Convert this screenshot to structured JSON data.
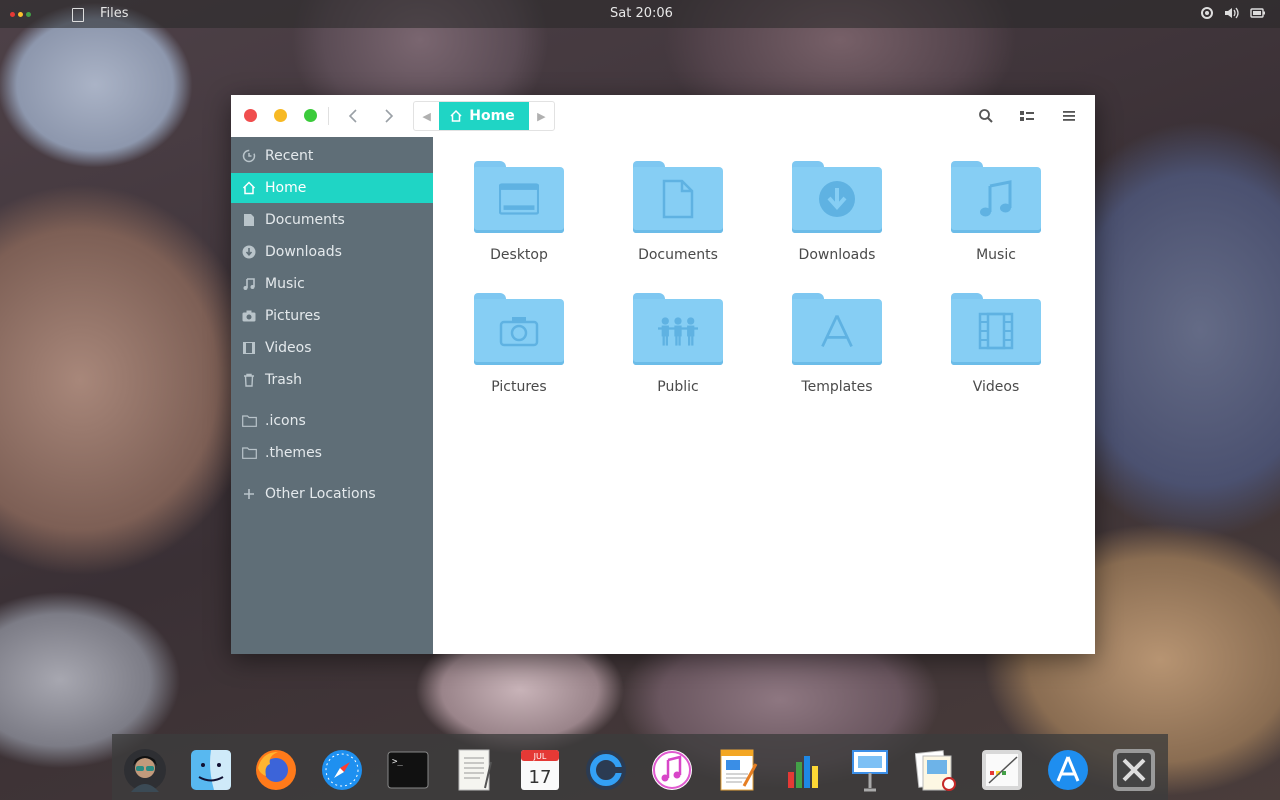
{
  "topbar": {
    "app_name": "Files",
    "clock": "Sat 20:06",
    "tray_icons": [
      "network-icon",
      "volume-icon",
      "battery-icon"
    ],
    "dots_colors": [
      "#e53935",
      "#fbc02d",
      "#43a047"
    ]
  },
  "window": {
    "traffic_lights": {
      "close": "#f04e4e",
      "minimize": "#f7b924",
      "maximize": "#3bcb3b"
    },
    "breadcrumb": {
      "current": "Home"
    },
    "accent": "#1fd5c5"
  },
  "sidebar": {
    "items": [
      {
        "label": "Recent",
        "icon": "recent-icon"
      },
      {
        "label": "Home",
        "icon": "home-icon",
        "active": true
      },
      {
        "label": "Documents",
        "icon": "document-icon"
      },
      {
        "label": "Downloads",
        "icon": "download-icon"
      },
      {
        "label": "Music",
        "icon": "music-icon"
      },
      {
        "label": "Pictures",
        "icon": "camera-icon"
      },
      {
        "label": "Videos",
        "icon": "film-icon"
      },
      {
        "label": "Trash",
        "icon": "trash-icon"
      }
    ],
    "bookmarks": [
      {
        "label": ".icons",
        "icon": "folder-icon"
      },
      {
        "label": ".themes",
        "icon": "folder-icon"
      }
    ],
    "other": {
      "label": "Other Locations",
      "icon": "plus-icon"
    }
  },
  "folders": [
    {
      "label": "Desktop",
      "icon": "desktop-icon"
    },
    {
      "label": "Documents",
      "icon": "document-icon"
    },
    {
      "label": "Downloads",
      "icon": "download-icon"
    },
    {
      "label": "Music",
      "icon": "music-icon"
    },
    {
      "label": "Pictures",
      "icon": "camera-icon"
    },
    {
      "label": "Public",
      "icon": "people-icon"
    },
    {
      "label": "Templates",
      "icon": "templates-icon"
    },
    {
      "label": "Videos",
      "icon": "film-icon"
    }
  ],
  "dock": {
    "apps": [
      "avatar",
      "finder",
      "firefox",
      "safari",
      "terminal",
      "text-editor",
      "calendar",
      "browser",
      "itunes",
      "pages",
      "numbers",
      "keynote",
      "preview",
      "notes",
      "app-store",
      "system-tools"
    ],
    "calendar": {
      "month": "JUL",
      "day": "17"
    }
  }
}
